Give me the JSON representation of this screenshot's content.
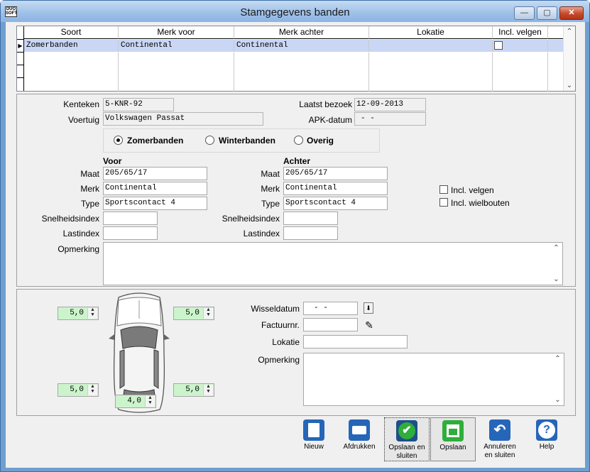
{
  "window": {
    "title": "Stamgegevens banden",
    "icon_label": "DUO SOFT"
  },
  "grid": {
    "columns": [
      "Soort",
      "Merk voor",
      "Merk achter",
      "Lokatie",
      "Incl. velgen"
    ],
    "rows": [
      {
        "soort": "Zomerbanden",
        "merk_voor": "Continental",
        "merk_achter": "Continental",
        "lokatie": "",
        "incl_velgen": false
      }
    ]
  },
  "form": {
    "kenteken_label": "Kenteken",
    "kenteken": "5-KNR-92",
    "voertuig_label": "Voertuig",
    "voertuig": "Volkswagen Passat",
    "laatst_bezoek_label": "Laatst bezoek",
    "laatst_bezoek": "12-09-2013",
    "apk_label": "APK-datum",
    "apk": "  -  -",
    "seasons": [
      "Zomerbanden",
      "Winterbanden",
      "Overig"
    ],
    "selected_season": "Zomerbanden",
    "voor": {
      "heading": "Voor",
      "maat": "205/65/17",
      "merk": "Continental",
      "type": "Sportscontact 4",
      "snelheidsindex": "",
      "lastindex": ""
    },
    "achter": {
      "heading": "Achter",
      "maat": "205/65/17",
      "merk": "Continental",
      "type": "Sportscontact 4",
      "snelheidsindex": "",
      "lastindex": ""
    },
    "labels": {
      "maat": "Maat",
      "merk": "Merk",
      "type": "Type",
      "snelheidsindex": "Snelheidsindex",
      "lastindex": "Lastindex",
      "opmerking": "Opmerking"
    },
    "incl_velgen": "Incl. velgen",
    "incl_wielbouten": "Incl. wielbouten"
  },
  "tread": {
    "front_left": "5,0",
    "front_right": "5,0",
    "rear_left": "5,0",
    "rear_right": "5,0",
    "spare": "4,0"
  },
  "swap": {
    "wisseldatum_label": "Wisseldatum",
    "wisseldatum": "  -  -",
    "factuurnr_label": "Factuurnr.",
    "factuurnr": "",
    "lokatie_label": "Lokatie",
    "lokatie": "",
    "opmerking_label": "Opmerking"
  },
  "toolbar": {
    "nieuw": "Nieuw",
    "afdrukken": "Afdrukken",
    "opslaan_sluiten_1": "Opslaan en",
    "opslaan_sluiten_2": "sluiten",
    "opslaan": "Opslaan",
    "annuleren_1": "Annuleren",
    "annuleren_2": "en sluiten",
    "help": "Help"
  },
  "colors": {
    "accent_blue": "#2566b8",
    "tread_green": "#ccf4cc",
    "selected_row": "#c9d6f4"
  }
}
